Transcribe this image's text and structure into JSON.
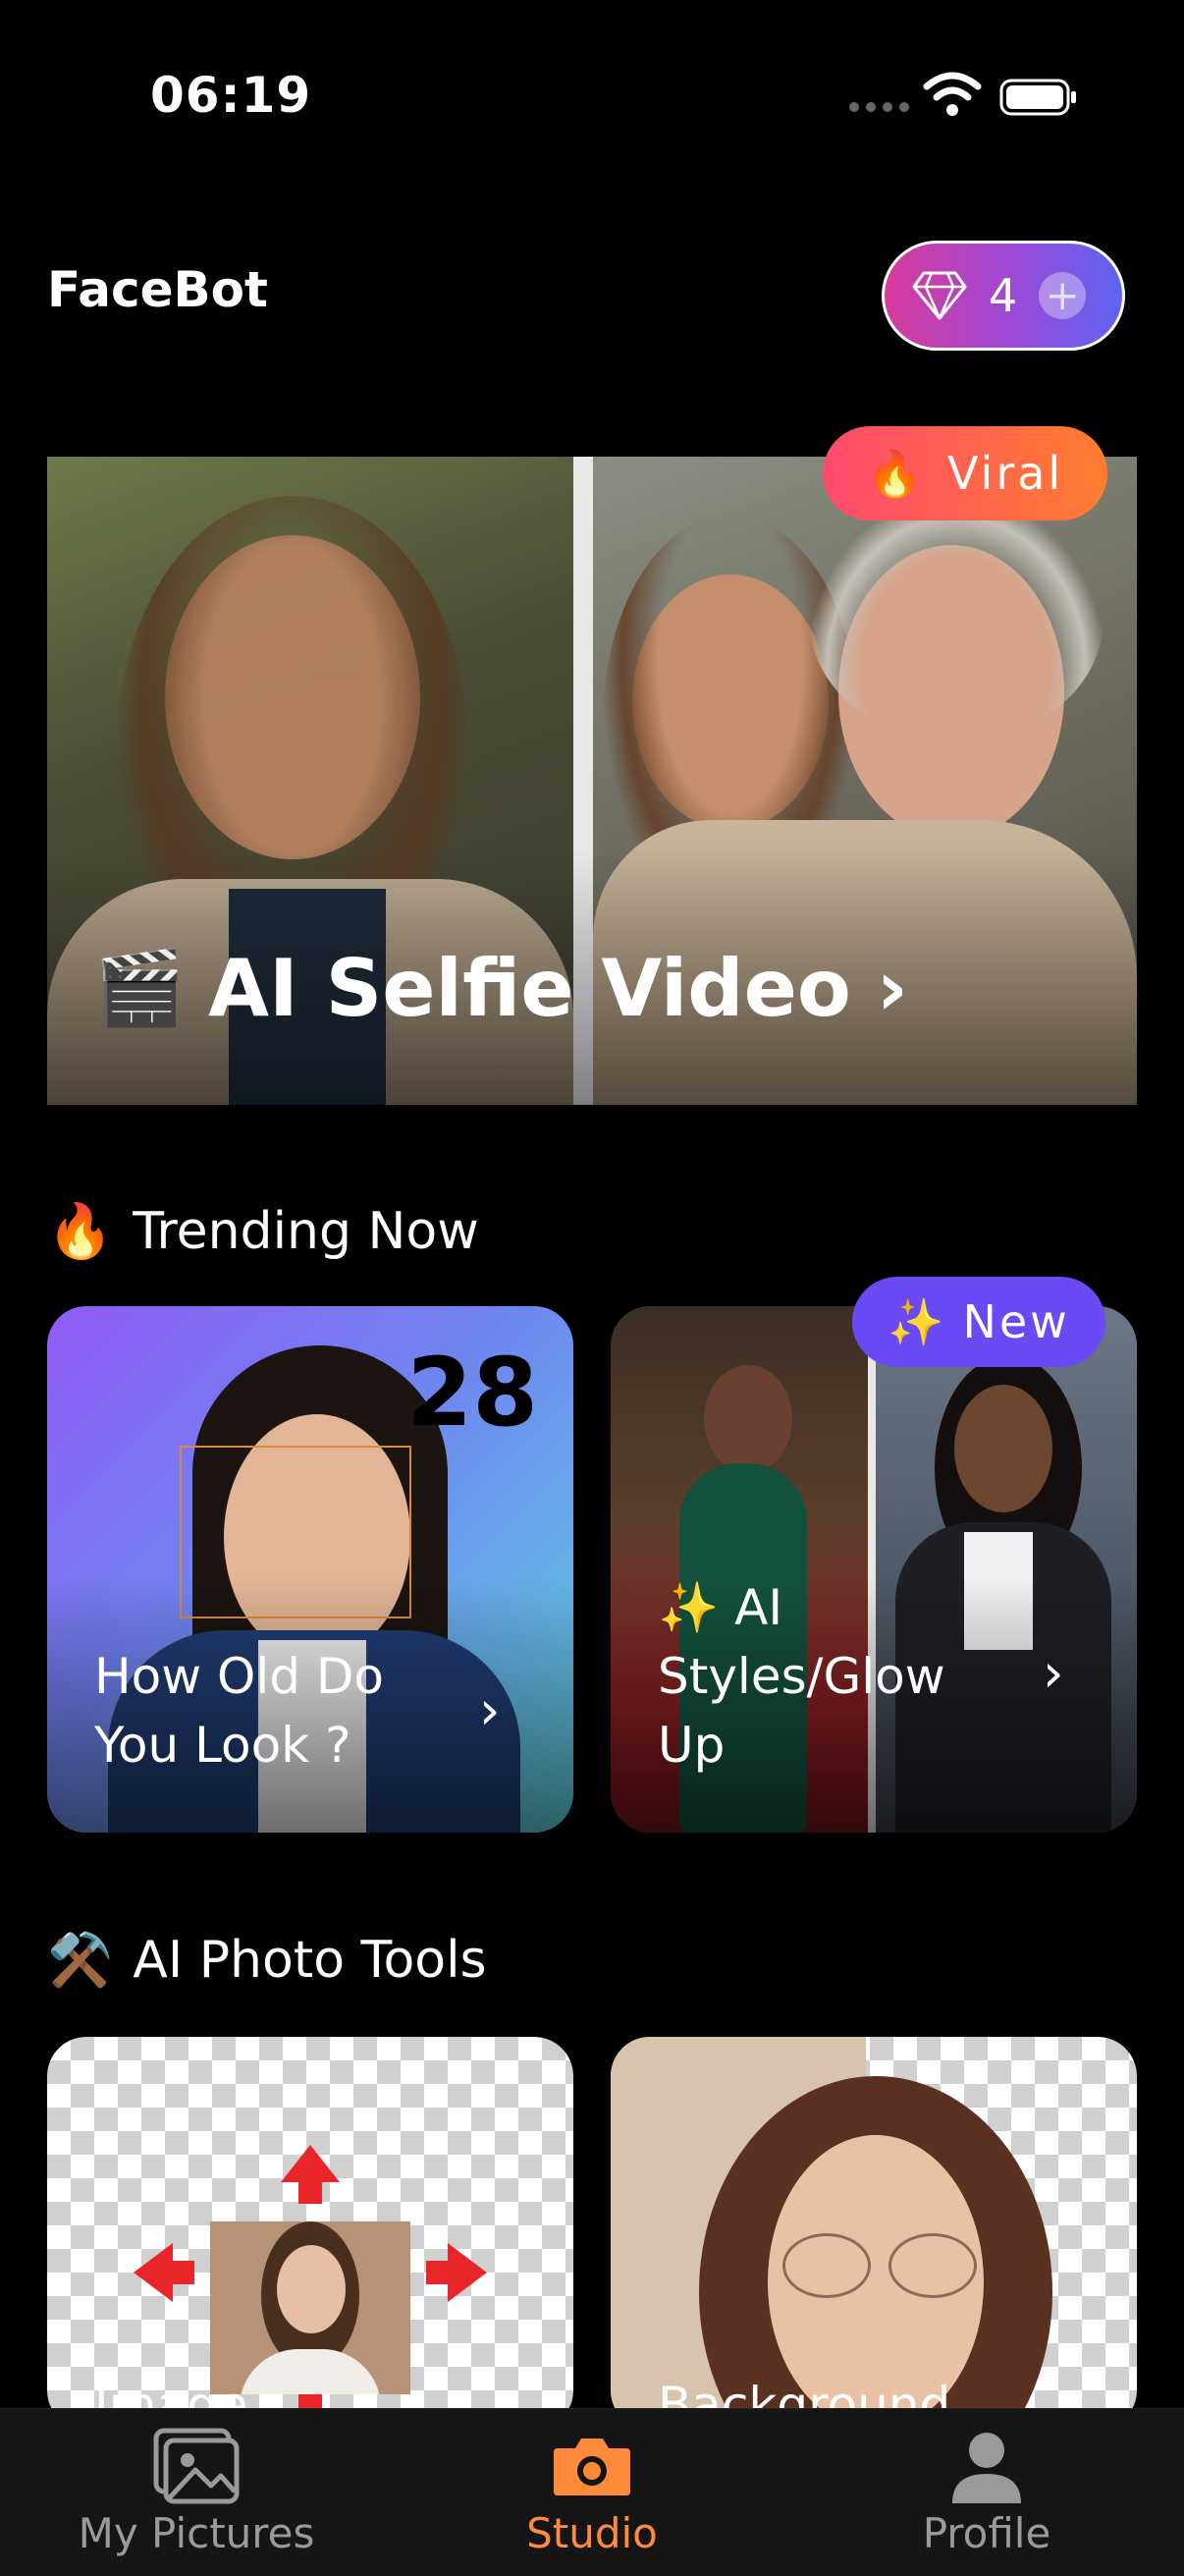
{
  "status_bar": {
    "time": "06:19"
  },
  "header": {
    "app_title": "FaceBot",
    "gem_count": "4",
    "gem_plus": "+"
  },
  "hero": {
    "badge_emoji": "🔥",
    "badge_label": "Viral",
    "emoji": "🎬",
    "label": "AI Selfie Video",
    "chevron": "›"
  },
  "trending": {
    "emoji": "🔥",
    "title": "Trending Now",
    "cards": [
      {
        "label_line1": "How Old Do",
        "label_line2": "You Look ?",
        "age": "28",
        "chevron": "›"
      },
      {
        "label_line1": "✨ AI",
        "label_line2": "Styles/Glow",
        "label_line3": "Up",
        "badge_emoji": "✨",
        "badge_label": "New",
        "chevron": "›"
      }
    ]
  },
  "tools": {
    "emoji": "⚒️",
    "title": "AI Photo Tools",
    "cards": [
      {
        "label": "Image"
      },
      {
        "label": "Background"
      }
    ]
  },
  "bottom_nav": {
    "items": [
      {
        "label": "My Pictures",
        "icon": "pictures-icon"
      },
      {
        "label": "Studio",
        "icon": "camera-icon",
        "active": true
      },
      {
        "label": "Profile",
        "icon": "person-icon"
      }
    ]
  },
  "colors": {
    "accent": "#ff8a3c",
    "new_badge": "#6b4af5",
    "viral_start": "#ff4a6e",
    "viral_end": "#ff7d2e"
  }
}
